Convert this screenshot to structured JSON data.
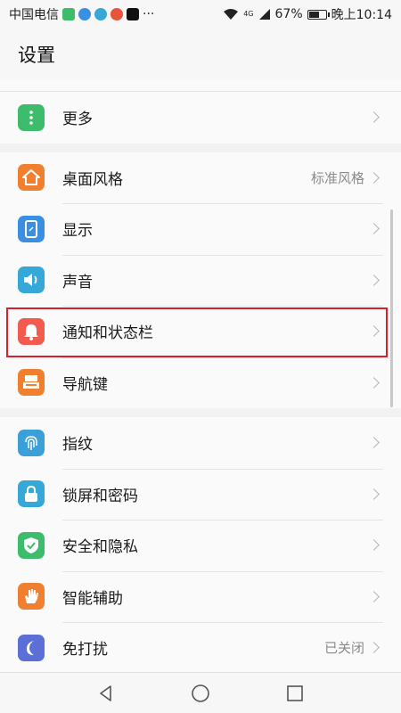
{
  "status_bar": {
    "carrier": "中国电信",
    "more": "···",
    "network": "4G",
    "battery_text": "67%",
    "battery_level": 0.67,
    "time": "晚上10:14"
  },
  "header": {
    "title": "设置"
  },
  "items": {
    "more": {
      "label": "更多",
      "icon": "more-dots-icon",
      "color": "#3dbd6b"
    },
    "desktop_style": {
      "label": "桌面风格",
      "value": "标准风格",
      "icon": "home-icon",
      "color": "#f08030"
    },
    "display": {
      "label": "显示",
      "icon": "display-phone-icon",
      "color": "#3b8fe0"
    },
    "sound": {
      "label": "声音",
      "icon": "speaker-icon",
      "color": "#36a8d8"
    },
    "notifications": {
      "label": "通知和状态栏",
      "icon": "bell-icon",
      "color": "#f25b4d"
    },
    "navigation_keys": {
      "label": "导航键",
      "icon": "keyboard-icon",
      "color": "#f08030"
    },
    "fingerprint": {
      "label": "指纹",
      "icon": "fingerprint-icon",
      "color": "#3b9fd8"
    },
    "lockscreen": {
      "label": "锁屏和密码",
      "icon": "lock-icon",
      "color": "#36a8d8"
    },
    "security": {
      "label": "安全和隐私",
      "icon": "shield-icon",
      "color": "#3dbd6b"
    },
    "smart_assist": {
      "label": "智能辅助",
      "icon": "hand-icon",
      "color": "#f08030"
    },
    "do_not_disturb": {
      "label": "免打扰",
      "value": "已关闭",
      "icon": "moon-icon",
      "color": "#5b6fd6"
    }
  },
  "highlight_color": "#d6202e"
}
